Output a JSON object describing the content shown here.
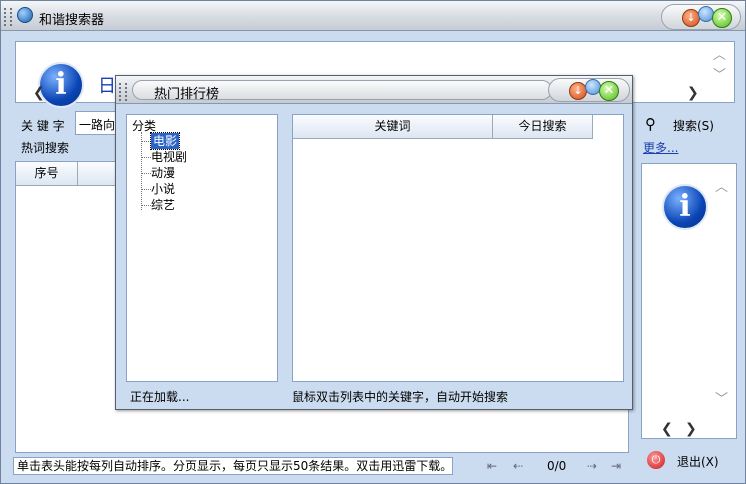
{
  "window": {
    "title": "和谐搜索器"
  },
  "main": {
    "headline_partial": "日",
    "keyword_label": "关 键 字",
    "keyword_value": "一路向",
    "hot_search_label": "热词搜索",
    "search_button": "搜索(S)",
    "more_link": "更多...",
    "table_headers": [
      "序号"
    ],
    "exit_button": "退出(X)"
  },
  "statusbar": {
    "hint": "单击表头能按每列自动排序。分页显示，每页只显示50条结果。双击用迅雷下载。",
    "page_indicator": "0/0"
  },
  "dialog": {
    "title": "热门排行榜",
    "tree_root": "分类",
    "categories": [
      "电影",
      "电视剧",
      "动漫",
      "小说",
      "综艺"
    ],
    "selected_category": "电影",
    "columns": [
      "关键词",
      "今日搜索"
    ],
    "status_left": "正在加载...",
    "status_right": "鼠标双击列表中的关键字，自动开始搜索"
  },
  "colors": {
    "frame_bg": "#ccdcf0",
    "selection": "#2a64c8",
    "link": "#1a3fb0"
  },
  "icons": {
    "info": "info-icon",
    "search": "magnifier-icon",
    "power": "power-icon"
  }
}
